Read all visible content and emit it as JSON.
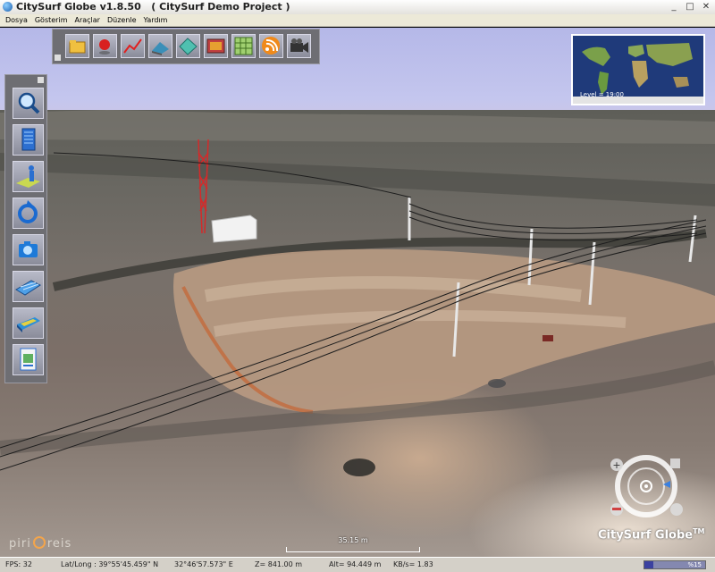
{
  "window": {
    "title": "CitySurf Globe v1.8.50   ( CitySurf Demo Project )",
    "controls": [
      "_",
      "□",
      "✕"
    ]
  },
  "menu": [
    "Dosya",
    "Gösterim",
    "Araçlar",
    "Düzenle",
    "Yardım"
  ],
  "top_toolbar": {
    "buttons": [
      "folder-icon",
      "placemark-icon",
      "chart-line-icon",
      "terrain-icon",
      "layer-icon",
      "image-icon",
      "grid-icon",
      "rss-icon",
      "camera-icon"
    ]
  },
  "left_toolbar": {
    "buttons": [
      "magnifier-icon",
      "building-icon",
      "person-icon",
      "rotate-icon",
      "photo-camera-icon",
      "solar-panel-icon",
      "scanner-icon",
      "document-icon"
    ]
  },
  "minimap": {
    "level_text": "Level = 19:00"
  },
  "scale": {
    "label": "35.15 m"
  },
  "branding": {
    "product": "CitySurf Globe",
    "tm": "TM",
    "logo_left": "piri",
    "logo_right": "reis"
  },
  "status": {
    "fps": "FPS: 32",
    "latlong": "Lat/Long : 39°55'45.459\" N",
    "long": "32°46'57.573\" E",
    "z": "Z= 841.00 m",
    "alt": "Alt= 94.449 m",
    "kbs": "KB/s= 1.83",
    "progress_pct": "%15",
    "progress": 0.15
  },
  "colors": {
    "sky": "#b5b8e8",
    "toolbar_bg": "#6e6e73",
    "status_bg": "#d4d0c8"
  }
}
